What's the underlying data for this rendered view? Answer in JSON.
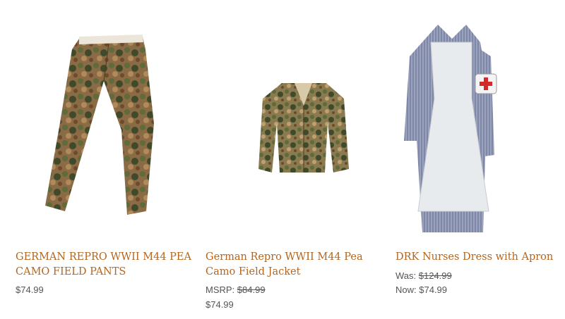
{
  "products": [
    {
      "title_line1": "GERMAN REPRO WWII M44 PEA",
      "title_line2": "CAMO FIELD PANTS",
      "price": "$74.99"
    },
    {
      "title_line1": "German Repro WWII M44 Pea",
      "title_line2": "Camo Field Jacket",
      "msrp_label": "MSRP:",
      "msrp_value": "$84.99",
      "price": "$74.99"
    },
    {
      "title_line1": "DRK Nurses Dress with Apron",
      "was_label": "Was:",
      "was_value": "$124.99",
      "now_label": "Now:",
      "now_value": "$74.99"
    }
  ],
  "colors": {
    "title": "#b5651d",
    "price": "#555555",
    "camo_base": "#8a6b45",
    "camo_green": "#5e6b3a",
    "dress_blue": "#8e96b0",
    "apron": "#e8ebee",
    "armband_cross": "#d42a2a"
  },
  "icons": [
    "pants-image",
    "jacket-image",
    "nurse-dress-image"
  ]
}
